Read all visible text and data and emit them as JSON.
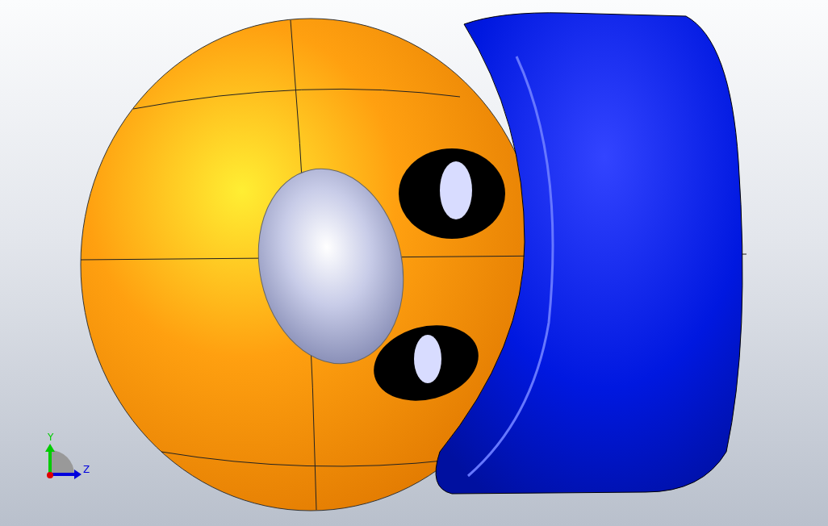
{
  "viewport": {
    "triad": {
      "axes": [
        {
          "label": "Y",
          "kind": "vertical",
          "color": "#00cc00"
        },
        {
          "label": "Z",
          "kind": "horizontal",
          "color": "#0000dd"
        }
      ]
    }
  }
}
